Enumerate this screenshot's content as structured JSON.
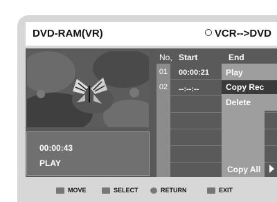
{
  "header": {
    "title": "DVD-RAM(VR)",
    "mode": "VCR-->DVD"
  },
  "playback": {
    "time": "00:00:43",
    "status": "PLAY"
  },
  "list": {
    "col_no": "No,",
    "col_start": "Start",
    "col_end": "End",
    "rows": [
      {
        "no": "01",
        "start": "00:00:21"
      },
      {
        "no": "02",
        "start": "--:--:--"
      }
    ]
  },
  "menu": {
    "items": [
      "Play",
      "Copy Rec",
      "Delete"
    ],
    "selected": "Copy Rec"
  },
  "copy_all_label": "Copy All",
  "footer": {
    "move": "MOVE",
    "select": "SELECT",
    "return": "RETURN",
    "exit": "EXIT"
  }
}
